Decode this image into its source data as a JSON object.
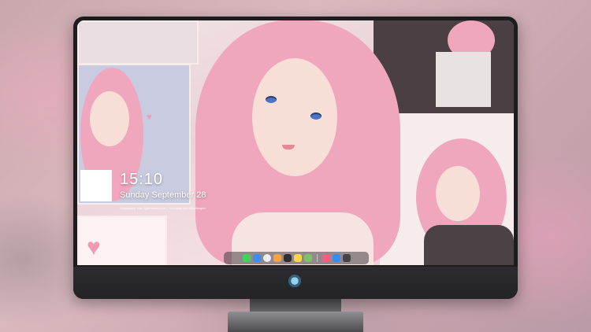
{
  "lock_screen": {
    "time": "15:10",
    "date": "Sunday September 28",
    "note": "Hinweistext zum Sperrbildschirm – Vorschau der Mitteilungen"
  },
  "dock": {
    "items": [
      {
        "icon": "messages-icon",
        "color": "#3fd35a"
      },
      {
        "icon": "finder-icon",
        "color": "#3d8ef5"
      },
      {
        "icon": "safari-icon",
        "color": "#eeeeee"
      },
      {
        "icon": "photos-icon",
        "color": "#f6a142"
      },
      {
        "icon": "clapper-icon",
        "color": "#2f2f33"
      },
      {
        "icon": "notes-icon",
        "color": "#f7d648"
      },
      {
        "icon": "calendar-icon",
        "color": "#7fc06a"
      },
      {
        "icon": "music-icon",
        "color": "#fb5c84"
      },
      {
        "icon": "app-store-icon",
        "color": "#2f8ff5"
      },
      {
        "icon": "camera-icon",
        "color": "#44444a"
      }
    ]
  },
  "colors": {
    "monitor_bezel": "#1d1d20",
    "hair_pink": "#f0a6bd",
    "accent_blue": "#4a74c6"
  }
}
